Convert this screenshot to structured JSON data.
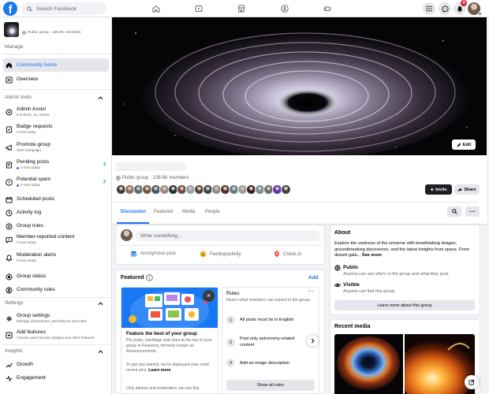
{
  "topbar": {
    "search_placeholder": "Search Facebook",
    "notifications_count": "4"
  },
  "sidebar": {
    "group_meta": "Public group · 238.6K members",
    "manage_label": "Manage",
    "community_home": "Community home",
    "overview": "Overview",
    "admin_tools_label": "Admin tools",
    "admin_assist": "Admin Assist",
    "admin_assist_sub": "5 actions, 12 criteria",
    "badge_requests": "Badge requests",
    "badge_requests_sub": "0 new today",
    "promote_group": "Promote group",
    "promote_group_sub": "Start campaign",
    "pending_posts": "Pending posts",
    "pending_posts_sub": "3 new today",
    "pending_posts_count": "3",
    "potential_spam": "Potential spam",
    "potential_spam_sub": "2 new today",
    "potential_spam_count": "2",
    "scheduled_posts": "Scheduled posts",
    "activity_log": "Activity log",
    "group_rules": "Group rules",
    "member_reported": "Member-reported content",
    "member_reported_sub": "0 new today",
    "moderation_alerts": "Moderation alerts",
    "moderation_alerts_sub": "0 new today",
    "group_status": "Group status",
    "community_roles": "Community roles",
    "settings_label": "Settings",
    "group_settings": "Group settings",
    "group_settings_sub": "Manage discussions, permissions and roles",
    "add_features": "Add features",
    "add_features_sub": "Choose post formats, badges and other features",
    "insights_label": "Insights",
    "growth": "Growth",
    "engagement": "Engagement"
  },
  "cover": {
    "edit_label": "Edit"
  },
  "group": {
    "meta": "Public group · 238.6K members",
    "invite_label": "Invite",
    "share_label": "Share",
    "tabs": [
      "Discussion",
      "Featured",
      "Media",
      "People"
    ]
  },
  "composer": {
    "placeholder": "Write something...",
    "anonymous_post": "Anonymous post",
    "feeling_activity": "Feeling/activity",
    "check_in": "Check in"
  },
  "featured": {
    "title": "Featured",
    "add_label": "Add",
    "promo_title": "Feature the best of your group",
    "promo_body": "Pin posts, hashtags and rules at the top of your group in Featured, formerly known as Announcements.",
    "promo_body2": "To get you started, we've displayed your most recent pins.",
    "learn_more": "Learn more",
    "promo_footer": "Only admins and moderators can see this.",
    "rules_title": "Rules",
    "rules_sub": "Here's what members can expect in the group.",
    "rules": [
      {
        "num": "1",
        "text": "All posts must be in English"
      },
      {
        "num": "2",
        "text": "Post only astronomy-related content"
      },
      {
        "num": "3",
        "text": "Add an image description"
      }
    ],
    "show_all_rules": "Show all rules"
  },
  "about": {
    "title": "About",
    "description": "Explore the vastness of the universe with breathtaking images, groundbreaking discoveries, and the latest insights from space. From distant gala...",
    "see_more": "See more",
    "public_title": "Public",
    "public_desc": "Anyone can see who's in the group and what they post.",
    "visible_title": "Visible",
    "visible_desc": "Anyone can find this group.",
    "learn_more_button": "Learn more about this group"
  },
  "recent_media": {
    "title": "Recent media"
  },
  "colors": {
    "brand": "#1877f2",
    "background": "#f0f2f5",
    "badge_red": "#e41e3f",
    "text_primary": "#050505",
    "text_secondary": "#65676b"
  },
  "icons": [
    "facebook-logo",
    "search-icon",
    "home-icon",
    "video-icon",
    "marketplace-icon",
    "groups-icon",
    "gaming-icon",
    "menu-grid-icon",
    "messenger-icon",
    "bell-icon"
  ]
}
